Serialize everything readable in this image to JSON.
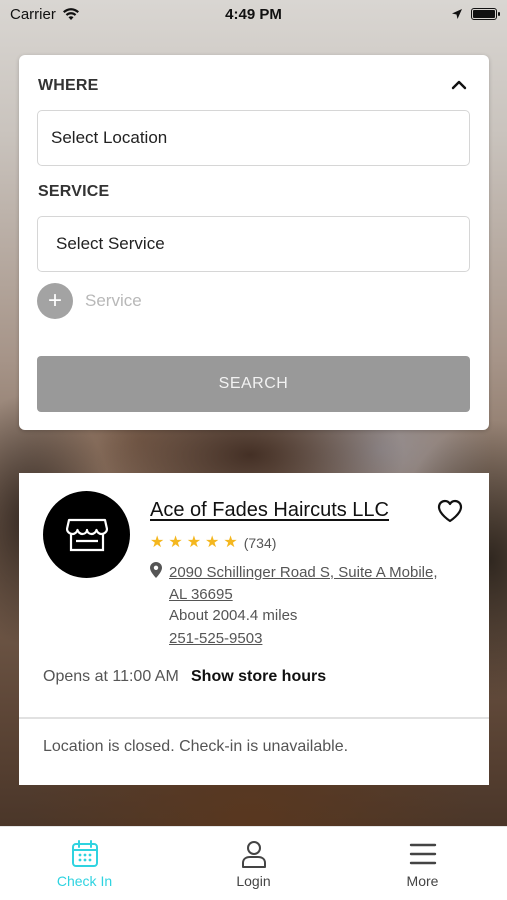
{
  "status_bar": {
    "carrier": "Carrier",
    "time": "4:49 PM",
    "icons": [
      "wifi-icon",
      "location-arrow-icon",
      "battery-icon"
    ]
  },
  "search": {
    "where_label": "WHERE",
    "location_placeholder": "Select Location",
    "service_label": "SERVICE",
    "service_placeholder": "Select Service",
    "add_service_label": "Service",
    "search_button": "SEARCH"
  },
  "store": {
    "name": "Ace of Fades Haircuts LLC",
    "rating": 5,
    "review_count": "(734)",
    "address": "2090 Schillinger Road S, Suite A Mobile, AL 36695",
    "distance": "About 2004.4 miles",
    "phone": "251-525-9503",
    "opens_text": "Opens at 11:00 AM",
    "hours_link": "Show store hours",
    "status_message": "Location is closed. Check-in is unavailable."
  },
  "tab_bar": {
    "tabs": [
      {
        "label": "Check In",
        "icon": "calendar-icon",
        "active": true
      },
      {
        "label": "Login",
        "icon": "user-icon",
        "active": false
      },
      {
        "label": "More",
        "icon": "menu-icon",
        "active": false
      }
    ]
  },
  "colors": {
    "accent": "#2fd3e0",
    "star": "#f4b71f",
    "search_button": "#999999",
    "logo_bg": "#000000"
  }
}
